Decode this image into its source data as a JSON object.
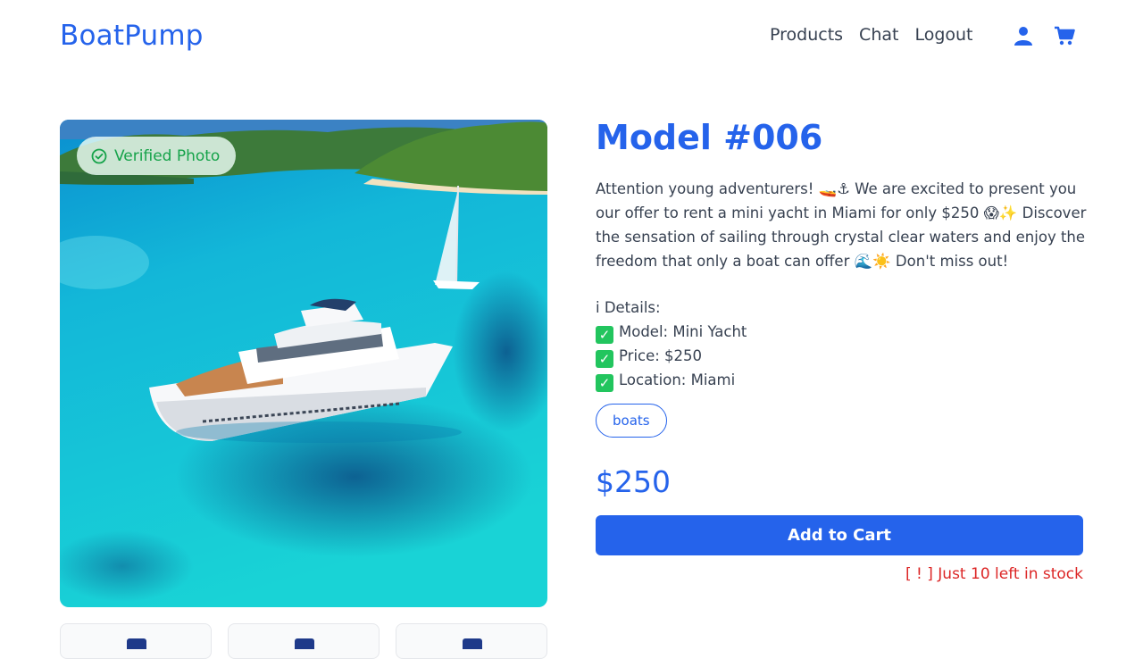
{
  "header": {
    "logo": "BoatPump",
    "nav": [
      "Products",
      "Chat",
      "Logout"
    ],
    "icons": [
      "user-icon",
      "cart-icon"
    ]
  },
  "media": {
    "badge": "Verified Photo",
    "badge_icon": "check-circle-icon"
  },
  "product": {
    "title": "Model #006",
    "description": "Attention young adventurers! 🚤⚓ We are excited to present you our offer to rent a mini yacht in Miami for only $250 😱✨ Discover the sensation of sailing through crystal clear waters and enjoy the freedom that only a boat can offer 🌊☀️ Don't miss out!",
    "details_heading": "i  Details:",
    "details": [
      "Model: Mini Yacht",
      "Price: $250",
      "Location: Miami"
    ],
    "tag": "boats",
    "price": "$250",
    "add_to_cart": "Add to Cart",
    "stock_notice": "[ ! ] Just 10 left in stock"
  },
  "colors": {
    "accent": "#2563eb",
    "success": "#16a34a",
    "danger": "#dc2626"
  }
}
